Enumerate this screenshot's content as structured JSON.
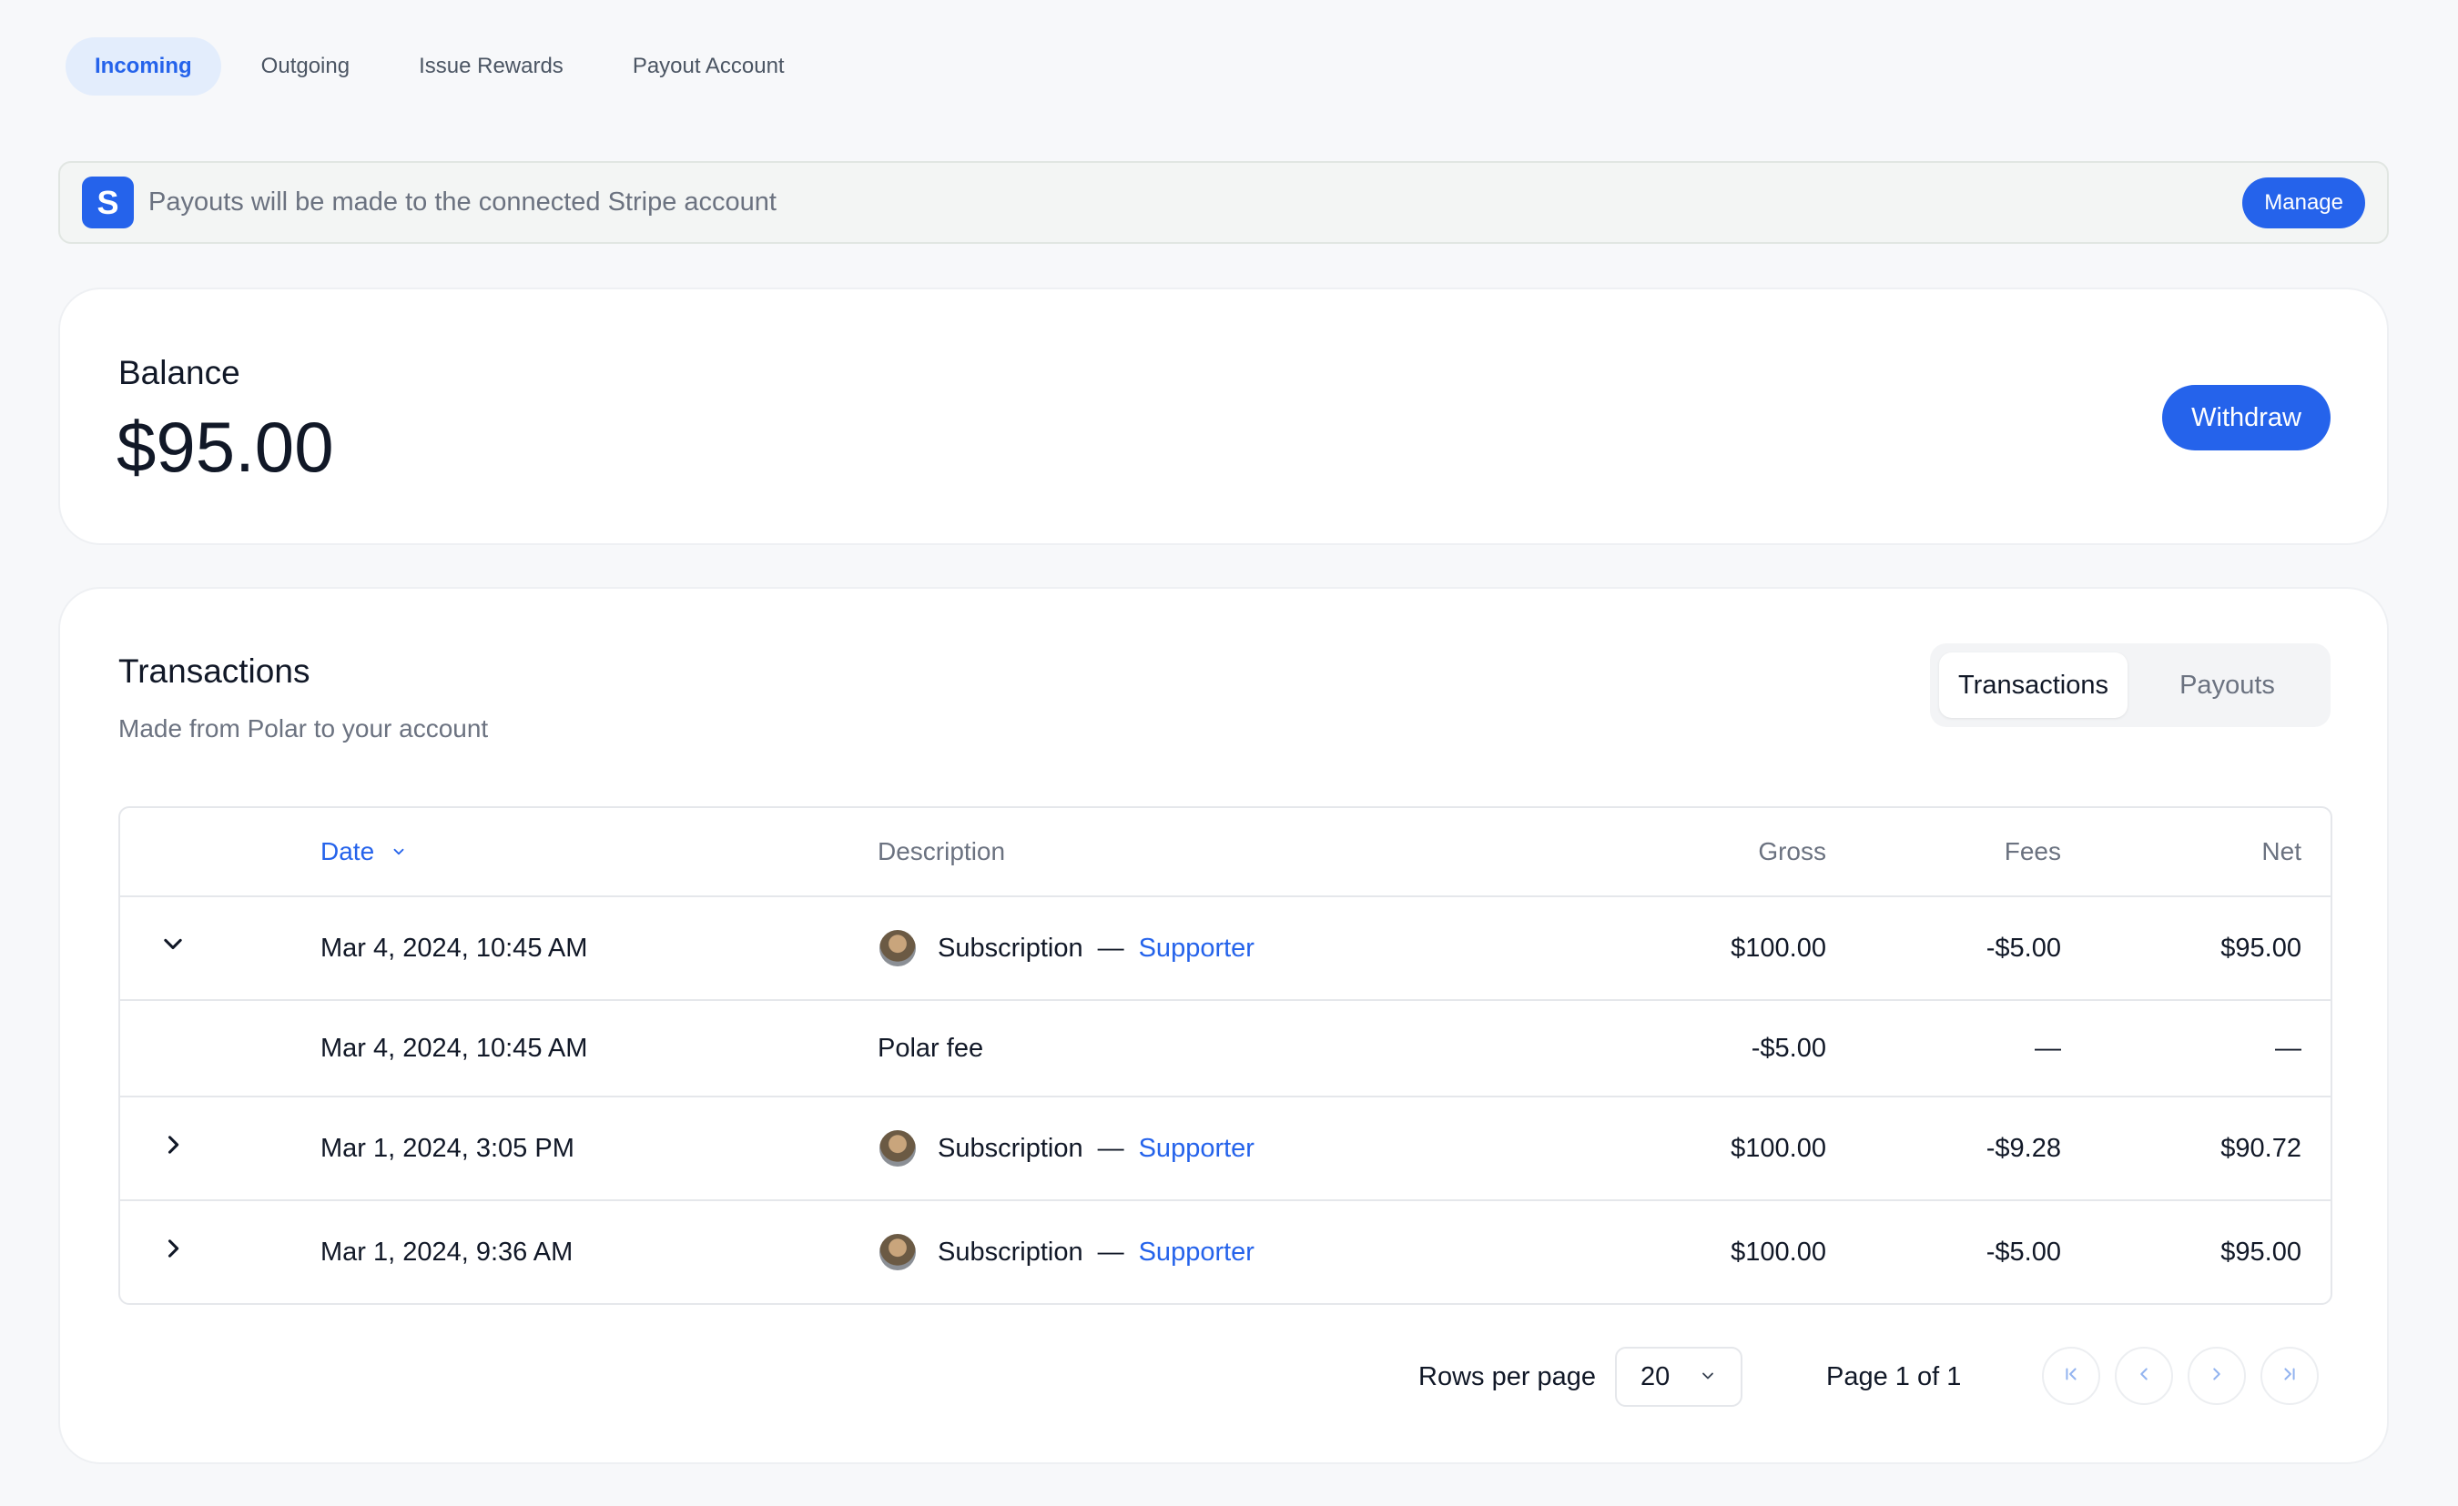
{
  "top_tabs": [
    {
      "label": "Incoming",
      "active": true
    },
    {
      "label": "Outgoing",
      "active": false
    },
    {
      "label": "Issue Rewards",
      "active": false
    },
    {
      "label": "Payout Account",
      "active": false
    }
  ],
  "banner": {
    "logo_letter": "S",
    "text": "Payouts will be made to the connected Stripe account",
    "manage_label": "Manage"
  },
  "balance": {
    "label": "Balance",
    "amount": "$95.00",
    "withdraw_label": "Withdraw"
  },
  "transactions": {
    "title": "Transactions",
    "subtitle": "Made from Polar to your account",
    "segment": [
      {
        "label": "Transactions",
        "active": true
      },
      {
        "label": "Payouts",
        "active": false
      }
    ],
    "columns": {
      "date": "Date",
      "description": "Description",
      "gross": "Gross",
      "fees": "Fees",
      "net": "Net"
    },
    "rows": [
      {
        "toggle": "expanded",
        "date": "Mar 4, 2024, 10:45 AM",
        "type": "Subscription",
        "dash": "—",
        "tier": "Supporter",
        "gross": "$100.00",
        "fees": "-$5.00",
        "net": "$95.00"
      },
      {
        "toggle": "none",
        "date": "Mar 4, 2024, 10:45 AM",
        "description": "Polar fee",
        "gross": "-$5.00",
        "fees": "—",
        "net": "—"
      },
      {
        "toggle": "collapsed",
        "date": "Mar 1, 2024, 3:05 PM",
        "type": "Subscription",
        "dash": "—",
        "tier": "Supporter",
        "gross": "$100.00",
        "fees": "-$9.28",
        "net": "$90.72"
      },
      {
        "toggle": "collapsed",
        "date": "Mar 1, 2024, 9:36 AM",
        "type": "Subscription",
        "dash": "—",
        "tier": "Supporter",
        "gross": "$100.00",
        "fees": "-$5.00",
        "net": "$95.00"
      }
    ],
    "pagination": {
      "rows_per_page_label": "Rows per page",
      "rows_per_page_value": "20",
      "page_info": "Page 1 of 1"
    }
  },
  "colors": {
    "accent": "#2563eb",
    "active_tab_bg": "#e3edfc",
    "background": "#f7f8fa"
  }
}
